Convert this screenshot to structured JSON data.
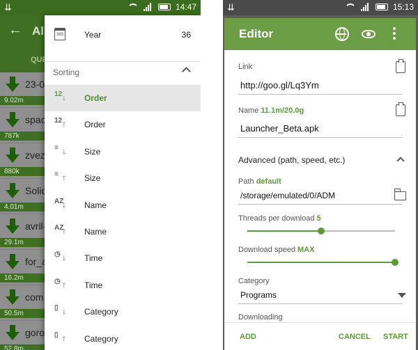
{
  "left": {
    "status_time": "14:47",
    "app_title": "Al",
    "tab_label": "QUE",
    "downloads": [
      {
        "name": "23-0",
        "size": "9.02m"
      },
      {
        "name": "spac",
        "size": "787k"
      },
      {
        "name": "zvez",
        "size": "880k"
      },
      {
        "name": "Solid",
        "size": "4.01m"
      },
      {
        "name": "avril-",
        "size": "29.1m"
      },
      {
        "name": "for_a",
        "size": "16.2m"
      },
      {
        "name": "com",
        "size": "50.5m"
      },
      {
        "name": "goro",
        "size": "52.8m"
      }
    ],
    "drawer": {
      "year_label": "Year",
      "year_value": "36",
      "calendar_text": "365",
      "sorting_label": "Sorting",
      "sort_items": [
        {
          "label": "Order",
          "icon": "order-ascending-icon",
          "glyph": "12",
          "arrow": "↓"
        },
        {
          "label": "Order",
          "icon": "order-descending-icon",
          "glyph": "12",
          "arrow": "↑"
        },
        {
          "label": "Size",
          "icon": "size-ascending-icon",
          "glyph": "≡",
          "arrow": "↓"
        },
        {
          "label": "Size",
          "icon": "size-descending-icon",
          "glyph": "≡",
          "arrow": "↑"
        },
        {
          "label": "Name",
          "icon": "name-ascending-icon",
          "glyph": "AZ",
          "arrow": "↓"
        },
        {
          "label": "Name",
          "icon": "name-descending-icon",
          "glyph": "AZ",
          "arrow": "↑"
        },
        {
          "label": "Time",
          "icon": "time-ascending-icon",
          "glyph": "◷",
          "arrow": "↓"
        },
        {
          "label": "Time",
          "icon": "time-descending-icon",
          "glyph": "◷",
          "arrow": "↑"
        },
        {
          "label": "Category",
          "icon": "category-ascending-icon",
          "glyph": "▯",
          "arrow": "↓"
        },
        {
          "label": "Category",
          "icon": "category-descending-icon",
          "glyph": "▯",
          "arrow": "↑"
        }
      ],
      "active_sort_index": 0
    }
  },
  "right": {
    "status_time": "15:13",
    "editor_title": "Editor",
    "link_label": "Link",
    "link_value": "http://goo.gl/Lq3Ym",
    "name_label": "Name",
    "name_size": "11.1m/20.0g",
    "name_value": "Launcher_Beta.apk",
    "advanced_label": "Advanced (path, speed, etc.)",
    "path_label": "Path",
    "path_tag": "default",
    "path_value": "/storage/emulated/0/ADM",
    "threads_label": "Threads per download",
    "threads_value": "5",
    "threads_fraction": 0.5,
    "speed_label": "Download speed",
    "speed_value": "MAX",
    "speed_fraction": 1.0,
    "category_label": "Category",
    "category_value": "Programs",
    "downloading_label": "Downloading",
    "add_button": "ADD",
    "cancel_button": "CANCEL",
    "start_button": "START"
  },
  "colors": {
    "accent": "#5b9a3a",
    "toolbar": "#6a9d45",
    "dark_toolbar": "#3e6f22"
  }
}
